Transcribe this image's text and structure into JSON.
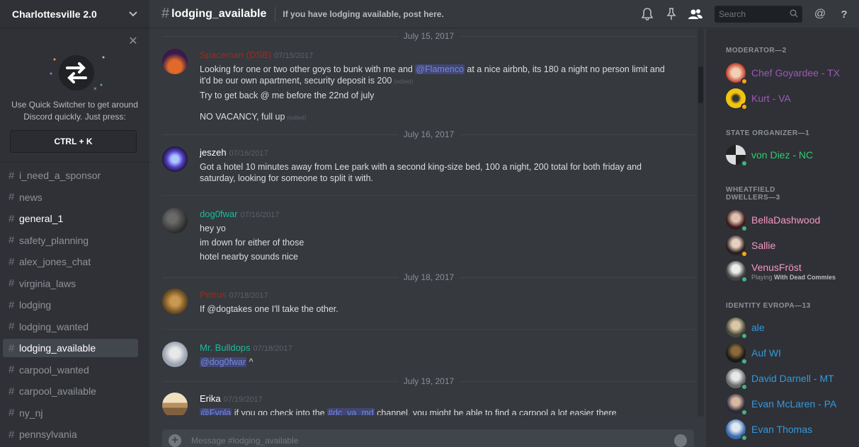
{
  "server": {
    "name": "Charlottesville 2.0"
  },
  "quick_switcher": {
    "text_line1": "Use Quick Switcher to get around",
    "text_line2": "Discord quickly. Just press:",
    "shortcut": "CTRL + K"
  },
  "channels": [
    {
      "name": "i_need_a_sponsor",
      "state": "read"
    },
    {
      "name": "news",
      "state": "read"
    },
    {
      "name": "general_1",
      "state": "unread"
    },
    {
      "name": "safety_planning",
      "state": "read"
    },
    {
      "name": "alex_jones_chat",
      "state": "read"
    },
    {
      "name": "virginia_laws",
      "state": "read"
    },
    {
      "name": "lodging",
      "state": "read"
    },
    {
      "name": "lodging_wanted",
      "state": "read"
    },
    {
      "name": "lodging_available",
      "state": "active"
    },
    {
      "name": "carpool_wanted",
      "state": "read"
    },
    {
      "name": "carpool_available",
      "state": "read"
    },
    {
      "name": "ny_nj",
      "state": "read"
    },
    {
      "name": "pennsylvania",
      "state": "read"
    }
  ],
  "header": {
    "channel_name": "lodging_available",
    "topic": "If you have lodging available, post here.",
    "search_placeholder": "Search"
  },
  "composer": {
    "placeholder": "Message #lodging_available"
  },
  "dividers": [
    "July 15, 2017",
    "July 16, 2017",
    "July 18, 2017",
    "July 19, 2017"
  ],
  "messages": [
    {
      "author": "Spaceman (DSB)",
      "author_color": "#992d22",
      "timestamp": "07/15/2017",
      "line1_a": "Looking for one or two other goys to bunk with me and ",
      "line1_mention": "@Flamenco",
      "line1_b": " at a nice airbnb, its 180 a night no person limit and",
      "line2": "it'd be our own apartment, security deposit is 200",
      "line3": "Try to get back @ me before the 22nd of july",
      "line4": "NO VACANCY, full up",
      "edited": "(edited)"
    },
    {
      "author": "jeszeh",
      "author_color": "#ffffff",
      "timestamp": "07/16/2017",
      "line1": "Got a hotel 10 minutes away from Lee park with a second king-size bed, 100 a night, 200 total for both friday and",
      "line2": "saturday, looking for someone to split it with."
    },
    {
      "author": "dog0fwar",
      "author_color": "#1abc9c",
      "timestamp": "07/16/2017",
      "line1": "hey yo",
      "line2": "im down for either of those",
      "line3": "hotel nearby sounds nice"
    },
    {
      "author": "Petrus",
      "author_color": "#992d22",
      "timestamp": "07/18/2017",
      "line1": "If @dogtakes one I'll take the other."
    },
    {
      "author": "Mr. Bulldops",
      "author_color": "#1abc9c",
      "timestamp": "07/18/2017",
      "mention": "@dog0fwar",
      "suffix": " ^"
    },
    {
      "author": "Erika",
      "author_color": "#ffffff",
      "timestamp": "07/19/2017",
      "mention": "@Fyola",
      "text_a": " if you go check into the ",
      "channel_mention": "#dc_va_md",
      "text_b": " channel, you might be able to find a carpool a lot easier there"
    }
  ],
  "roles": [
    {
      "label": "MODERATOR—2"
    },
    {
      "label": "STATE ORGANIZER—1"
    },
    {
      "label_line1": "WHEATFIELD",
      "label_line2": "DWELLERS—3"
    },
    {
      "label": "IDENTITY EVROPA—13"
    }
  ],
  "members": [
    {
      "name": "Chef Goyardee - TX",
      "color": "#9b59b6",
      "status": "idle"
    },
    {
      "name": "Kurt - VA",
      "color": "#9b59b6",
      "status": "idle"
    },
    {
      "name": "von Diez - NC",
      "color": "#2ecc71",
      "status": "online"
    },
    {
      "name": "BellaDashwood",
      "color": "#f49ac1",
      "status": "online"
    },
    {
      "name": "Sallie",
      "color": "#f49ac1",
      "status": "idle"
    },
    {
      "name": "VenusFröst",
      "color": "#f49ac1",
      "status": "online",
      "playing_label": "Playing",
      "playing_game": "With Dead Commies"
    },
    {
      "name": "ale",
      "color": "#3498db",
      "status": "online"
    },
    {
      "name": "Auf WI",
      "color": "#3498db",
      "status": "online"
    },
    {
      "name": "David Darnell - MT",
      "color": "#3498db",
      "status": "online"
    },
    {
      "name": "Evan McLaren - PA",
      "color": "#3498db",
      "status": "online"
    },
    {
      "name": "Evan Thomas",
      "color": "#3498db",
      "status": "online"
    }
  ]
}
